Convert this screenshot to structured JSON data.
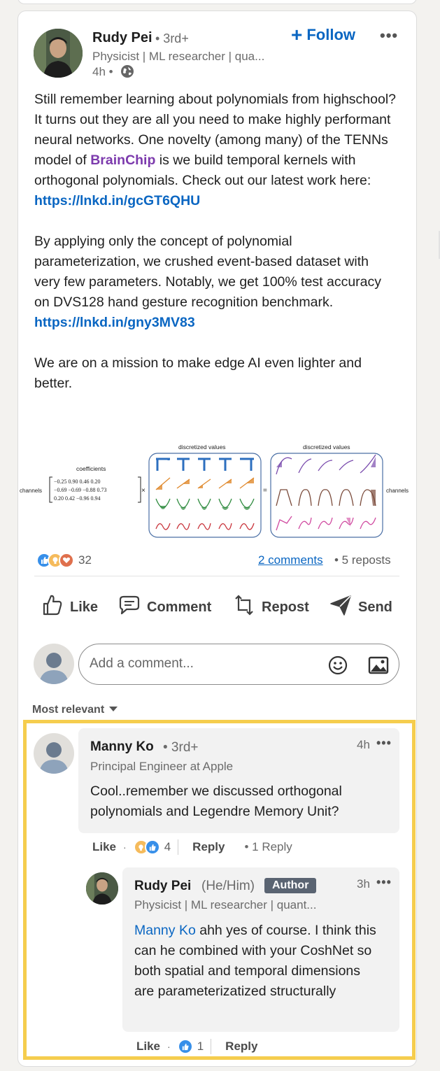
{
  "post": {
    "author": {
      "name": "Rudy Pei",
      "degree": "• 3rd+",
      "headline": "Physicist | ML researcher | qua...",
      "time": "4h •"
    },
    "follow_label": "Follow",
    "paragraphs": {
      "p1_before_mention": "Still remember learning about polynomials from highschool? It turns out they are all you need to make highly performant neural networks. One novelty (among many) of the TENNs model of ",
      "mention": "BrainChip",
      "p1_after_mention": " is we build temporal kernels with orthogonal polynomials. Check out our latest work here:",
      "link1": "https://lnkd.in/gcGT6QHU",
      "p2": "By applying only the concept of polynomial parameterization, we crushed event-based dataset with very few parameters. Notably, we get 100% test accuracy on DVS128 hand gesture recognition benchmark.",
      "link2": "https://lnkd.in/gny3MV83",
      "p3": "We are on a mission to make edge AI even lighter and better."
    },
    "figure": {
      "coefficients_label": "coefficients",
      "channels_label": "channels",
      "discretized_label": "discretized values",
      "matrix_rows": [
        "−0.25   0.90    0.46   0.20",
        "−0.69  −0.69  −0.88  0.73",
        " 0.20   0.42   −0.96  0.94"
      ],
      "times": "×",
      "equals": "="
    },
    "social": {
      "reaction_count": "32",
      "comments_label": "2 comments",
      "reposts_label": "• 5 reposts"
    },
    "actions": {
      "like": "Like",
      "comment": "Comment",
      "repost": "Repost",
      "send": "Send"
    },
    "comment_box": {
      "placeholder": "Add a comment..."
    },
    "sort_label": "Most relevant"
  },
  "comments": [
    {
      "name": "Manny Ko",
      "degree": "• 3rd+",
      "headline": "Principal Engineer at Apple",
      "time": "4h",
      "text": "Cool..remember we discussed orthogonal polynomials and Legendre Memory Unit?",
      "like_label": "Like",
      "reaction_count": "4",
      "reply_label": "Reply",
      "replies_label": "• 1 Reply"
    }
  ],
  "reply": {
    "name": "Rudy Pei",
    "pronouns": "(He/Him)",
    "badge": "Author",
    "headline": "Physicist | ML researcher | quant...",
    "time": "3h",
    "mention": "Manny Ko",
    "text": " ahh yes of course. I think this can he combined with your CoshNet so both spatial and temporal dimensions are parameterizatized structurally",
    "like_label": "Like",
    "reaction_count": "1",
    "reply_label": "Reply"
  },
  "colors": {
    "link": "#0a66c2",
    "mention": "#7c3aad",
    "highlight_border": "#f5cd4e",
    "author_badge": "#5a6472"
  }
}
